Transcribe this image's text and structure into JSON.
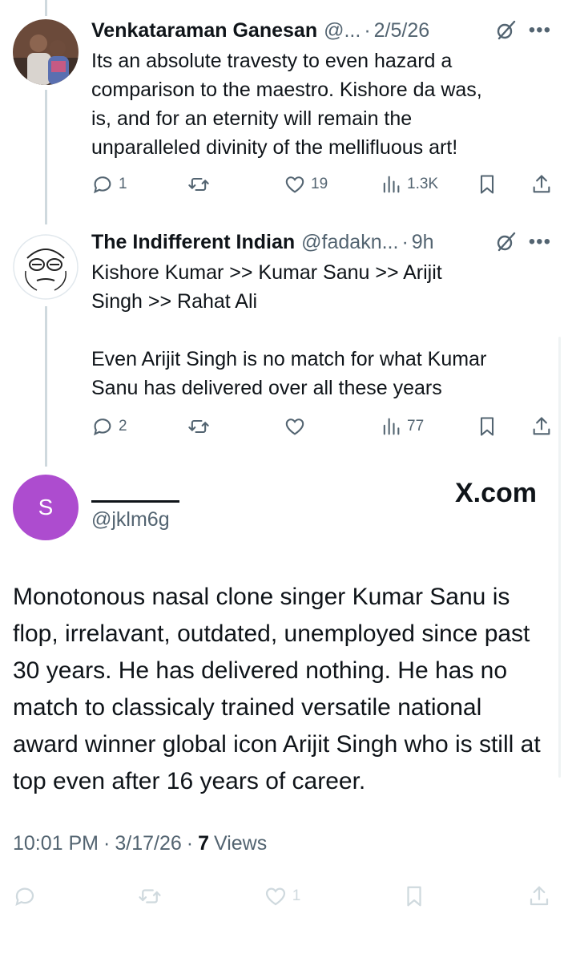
{
  "replies": [
    {
      "name": "Venkataraman Ganesan",
      "handle": "@...",
      "dot": "·",
      "time": "2/5/26",
      "text": "Its an absolute travesty to even hazard a\ncomparison to the maestro. Kishore da was,\nis, and for an eternity will remain the\nunparalleled divinity of the mellifluous art!",
      "replies": "1",
      "retweets": "",
      "likes": "19",
      "views": "1.3K"
    },
    {
      "name": "The Indifferent Indian",
      "handle": "@fadakn...",
      "dot": "·",
      "time": "9h",
      "text": "Kishore Kumar >> Kumar Sanu >> Arijit\nSingh >> Rahat Ali\n\nEven Arijit Singh is no match for what Kumar\nSanu has delivered over all these years",
      "replies": "2",
      "retweets": "",
      "likes": "",
      "views": "77"
    }
  ],
  "main": {
    "avatar_letter": "S",
    "handle": "@jklm6g",
    "site": "X.com",
    "text": "Monotonous nasal clone singer Kumar Sanu is flop, irrelavant, outdated, unemployed since past 30 years. He has delivered nothing. He has no match to classicaly trained versatile national award winner global icon Arijit Singh who is still at top even after 16 years of career.",
    "time": "10:01 PM",
    "date": "3/17/26",
    "sep": "·",
    "views_count": "7",
    "views_label": "Views",
    "likes": "1"
  },
  "colors": {
    "avatar_purple": "#ad4ccf",
    "secondary_text": "#536471",
    "thread_line": "#cfd9de"
  },
  "icons": {
    "grok": "grok-icon",
    "more": "more-icon",
    "reply": "reply-icon",
    "retweet": "retweet-icon",
    "like": "like-icon",
    "views": "views-icon",
    "bookmark": "bookmark-icon",
    "share": "share-icon"
  }
}
